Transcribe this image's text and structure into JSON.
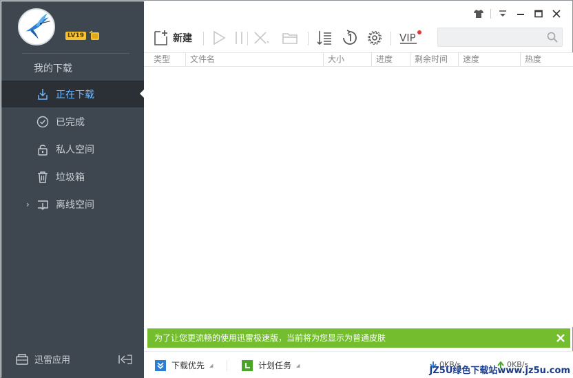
{
  "user": {
    "level": "LV19"
  },
  "sidebar": {
    "section_title": "我的下载",
    "items": [
      {
        "label": "正在下载",
        "icon": "download-arrow-icon",
        "active": true
      },
      {
        "label": "已完成",
        "icon": "check-circle-icon"
      },
      {
        "label": "私人空间",
        "icon": "lock-icon"
      },
      {
        "label": "垃圾箱",
        "icon": "trash-icon"
      },
      {
        "label": "离线空间",
        "icon": "cloud-download-icon",
        "expandable": true
      }
    ],
    "bottom_label": "迅雷应用"
  },
  "toolbar": {
    "new_label": "新建",
    "vip_label": "VIP",
    "search_placeholder": ""
  },
  "table": {
    "columns": [
      "类型",
      "文件名",
      "大小",
      "进度",
      "剩余时间",
      "速度",
      "热度"
    ]
  },
  "notification": {
    "text": "为了让您更流畅的使用迅雷极速版，当前将为您显示为普通皮肤"
  },
  "statusbar": {
    "download_priority_label": "下载优先",
    "scheduled_task_label": "计划任务",
    "download_speed": "0KB/s",
    "upload_speed": "0KB/s"
  },
  "watermark": "JZ5U绿色下载站www.jz5u.com",
  "colors": {
    "sidebar_bg": "#3e4750",
    "active_item_bg": "#2b3036",
    "active_text": "#6fb8ff",
    "notify_bg": "#73bd2e",
    "accent_blue": "#2a7fd4"
  }
}
